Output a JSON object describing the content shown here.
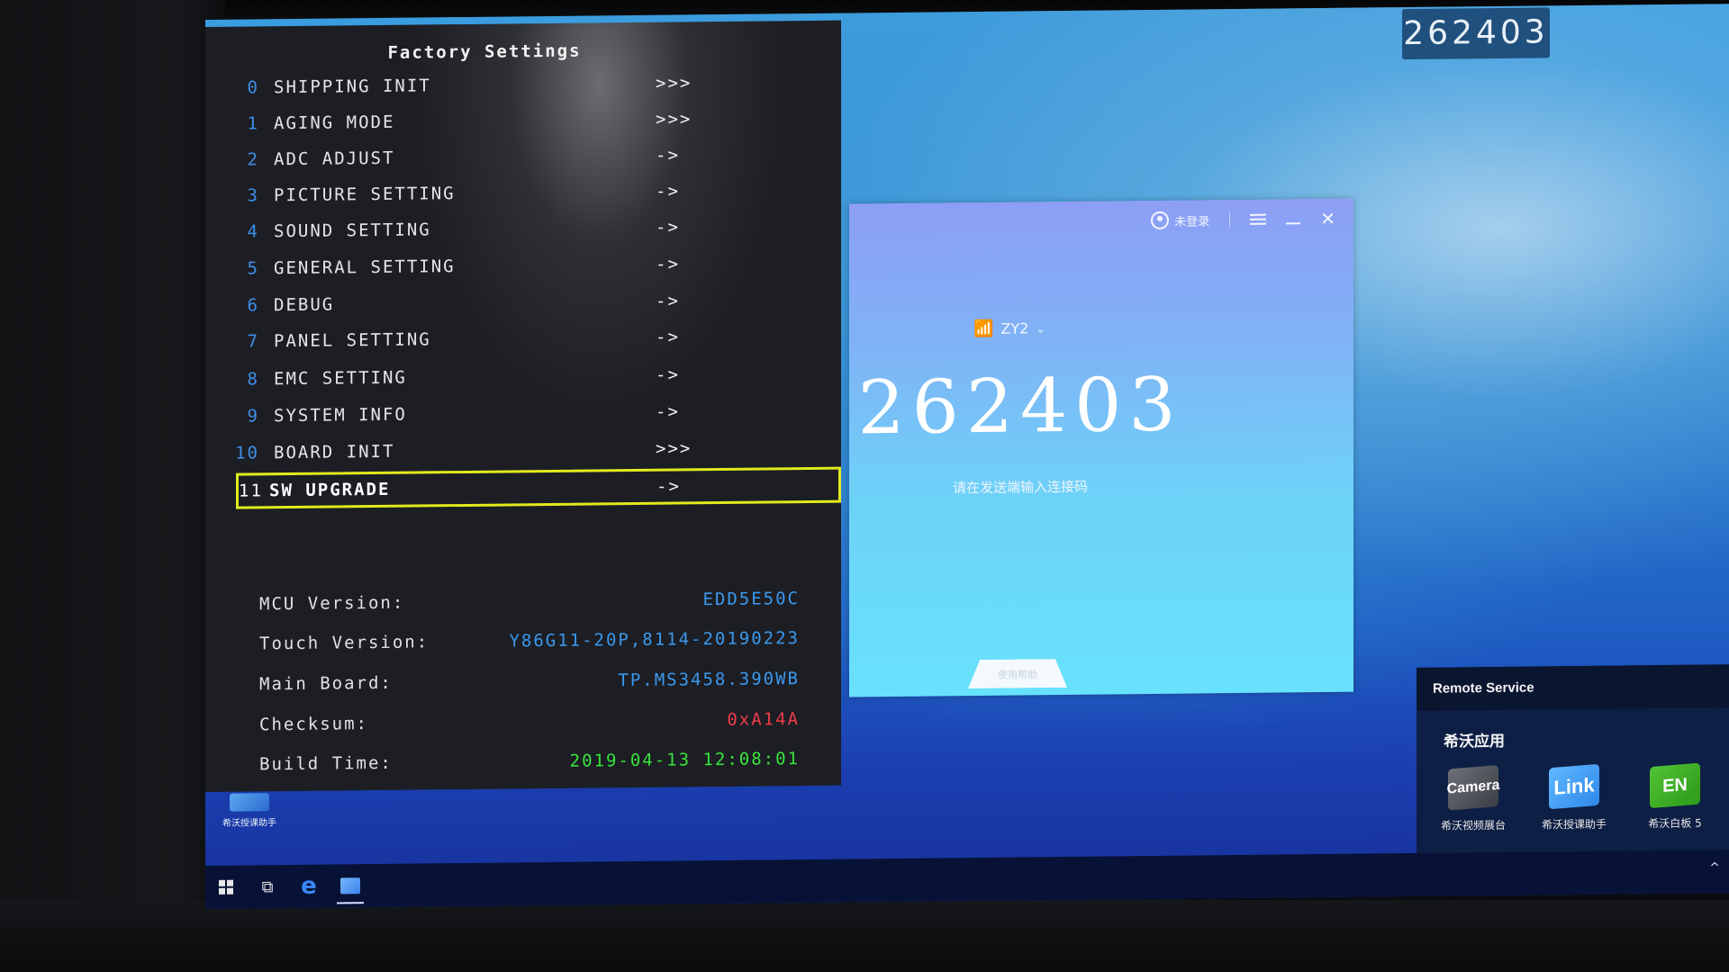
{
  "osd": {
    "title": "Factory Settings",
    "menu": [
      {
        "num": "0",
        "label": "SHIPPING INIT",
        "arrow": ">>>"
      },
      {
        "num": "1",
        "label": "AGING MODE",
        "arrow": ">>>"
      },
      {
        "num": "2",
        "label": "ADC ADJUST",
        "arrow": "->"
      },
      {
        "num": "3",
        "label": "PICTURE SETTING",
        "arrow": "->"
      },
      {
        "num": "4",
        "label": "SOUND SETTING",
        "arrow": "->"
      },
      {
        "num": "5",
        "label": "GENERAL SETTING",
        "arrow": "->"
      },
      {
        "num": "6",
        "label": "DEBUG",
        "arrow": "->"
      },
      {
        "num": "7",
        "label": "PANEL SETTING",
        "arrow": "->"
      },
      {
        "num": "8",
        "label": "EMC SETTING",
        "arrow": "->"
      },
      {
        "num": "9",
        "label": "SYSTEM INFO",
        "arrow": "->"
      },
      {
        "num": "10",
        "label": "BOARD INIT",
        "arrow": ">>>"
      },
      {
        "num": "11",
        "label": "SW UPGRADE",
        "arrow": "->",
        "selected": true
      }
    ],
    "info": [
      {
        "key": "MCU Version:",
        "value": "EDD5E50C",
        "color": "#3c98ec"
      },
      {
        "key": "Touch Version:",
        "value": "Y86G11-20P,8114-20190223",
        "color": "#3c98ec"
      },
      {
        "key": "Main Board:",
        "value": "TP.MS3458.390WB",
        "color": "#3c98ec"
      },
      {
        "key": "Checksum:",
        "value": "0xA14A",
        "color": "#ee3b4a"
      },
      {
        "key": "Build Time:",
        "value": "2019-04-13 12:08:01",
        "color": "#3ae23c"
      }
    ],
    "highlight_color": "#e2ea1c"
  },
  "code_badge": "262403",
  "remote_window": {
    "user_label": "未登录",
    "network": "ZY2",
    "code": "262403",
    "hint": "请在发送端输入连接码",
    "bottom_tab": "使用帮助"
  },
  "remote_service": {
    "title": "Remote Service",
    "group": "希沃应用",
    "apps": [
      {
        "icon_text": "Camera",
        "label": "希沃视频展台"
      },
      {
        "icon_text": "Link",
        "label": "希沃授课助手"
      },
      {
        "icon_text": "EN",
        "label": "希沃白板 5"
      }
    ]
  },
  "desktop": {
    "icon_label": "希沃授课助手"
  },
  "taskbar": {
    "tray_chevron": "^"
  }
}
